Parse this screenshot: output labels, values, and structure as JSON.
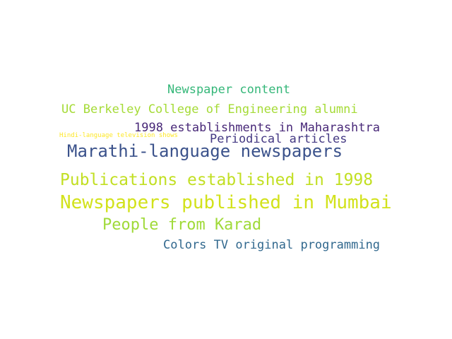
{
  "word_cloud": {
    "words": [
      {
        "text": "Newspaper content",
        "color": "#35b779"
      },
      {
        "text": "UC Berkeley College of Engineering alumni",
        "color": "#a5db36"
      },
      {
        "text": "1998 establishments in Maharashtra",
        "color": "#482878"
      },
      {
        "text": "Hindi-language television shows",
        "color": "#fde725"
      },
      {
        "text": "Periodical articles",
        "color": "#443983"
      },
      {
        "text": "Marathi-language newspapers",
        "color": "#3b528b"
      },
      {
        "text": "Publications established in 1998",
        "color": "#c2df23"
      },
      {
        "text": "Newspapers published in Mumbai",
        "color": "#d2e21b"
      },
      {
        "text": "People from Karad",
        "color": "#a0da39"
      },
      {
        "text": "Colors TV original programming",
        "color": "#31688e"
      }
    ]
  }
}
